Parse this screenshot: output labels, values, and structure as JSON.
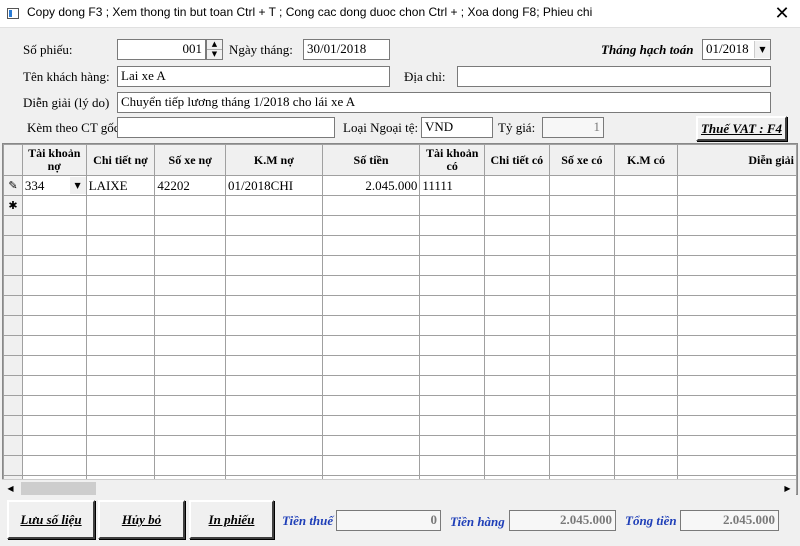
{
  "window": {
    "title": "Copy dong F3 ; Xem thong tin but toan Ctrl + T ; Cong cac dong duoc chon Ctrl + ; Xoa dong F8; Phieu chi",
    "close_glyph": "✕"
  },
  "form": {
    "so_phieu_label": "Số phiếu:",
    "so_phieu_value": "001",
    "ngay_thang_label": "Ngày tháng:",
    "ngay_thang_value": "30/01/2018",
    "thang_hach_toan_label": "Tháng hạch toán",
    "thang_hach_toan_value": "01/2018",
    "ten_khach_hang_label": "Tên khách hàng:",
    "ten_khach_hang_value": "Lai xe A",
    "dia_chi_label": "Địa chỉ:",
    "dia_chi_value": "",
    "dien_giai_label": "Diễn giải (lý do)",
    "dien_giai_value": "Chuyển tiếp lương tháng 1/2018 cho lái xe A",
    "kem_theo_label": "Kèm theo CT gốc",
    "kem_theo_value": "",
    "loai_ngoai_te_label": "Loại Ngoại tệ:",
    "loai_ngoai_te_value": "VND",
    "ty_gia_label": "Tỷ giá:",
    "ty_gia_value": "1",
    "thue_vat_button": "Thuế VAT : F4"
  },
  "grid": {
    "columns": [
      "Tài khoản nợ",
      "Chi tiết nợ",
      "Số xe nợ",
      "K.M nợ",
      "Số tiền",
      "Tài khoản có",
      "Chi tiết có",
      "Số xe có",
      "K.M có",
      "Diễn giải"
    ],
    "rows": [
      {
        "marker": "✎",
        "tk_no": "334",
        "ct_no": "LAIXE",
        "so_xe_no": "42202",
        "km_no": "01/2018CHI",
        "so_tien": "2.045.000",
        "tk_co": "11111",
        "ct_co": "",
        "so_xe_co": "",
        "km_co": "",
        "dien_giai": ""
      }
    ],
    "new_row_marker": "✱"
  },
  "footer": {
    "luu_button": "Lưu số liệu",
    "huy_button": "Hủy bỏ",
    "in_button": "In phiếu",
    "tien_thue_label": "Tiền thuế",
    "tien_thue_value": "0",
    "tien_hang_label": "Tiền hàng",
    "tien_hang_value": "2.045.000",
    "tong_tien_label": "Tổng tiền",
    "tong_tien_value": "2.045.000"
  }
}
